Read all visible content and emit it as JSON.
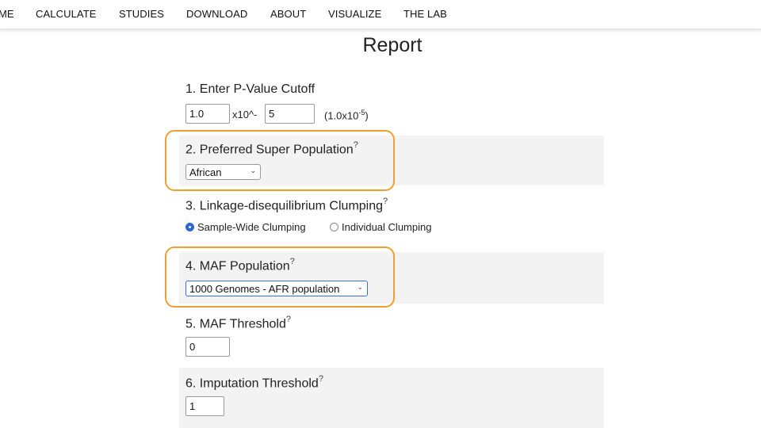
{
  "nav": {
    "items": [
      "ME",
      "CALCULATE",
      "STUDIES",
      "DOWNLOAD",
      "ABOUT",
      "VISUALIZE",
      "THE LAB"
    ]
  },
  "page": {
    "title": "Report"
  },
  "sections": {
    "pvalue": {
      "label": "1. Enter P-Value Cutoff",
      "mantissa": "1.0",
      "times_text": "x10^-",
      "exponent": "5",
      "display_base": "(1.0x10",
      "display_exp": "-5",
      "display_close": ")"
    },
    "super_population": {
      "label": "2. Preferred Super Population",
      "help": "?",
      "selected": "African"
    },
    "ld_clumping": {
      "label": "3. Linkage-disequilibrium Clumping",
      "help": "?",
      "options": [
        "Sample-Wide Clumping",
        "Individual Clumping"
      ],
      "selected_index": 0
    },
    "maf_population": {
      "label": "4. MAF Population",
      "help": "?",
      "selected": "1000 Genomes - AFR population"
    },
    "maf_threshold": {
      "label": "5. MAF Threshold",
      "help": "?",
      "value": "0"
    },
    "imputation_threshold": {
      "label": "6. Imputation Threshold",
      "help": "?",
      "value": "1"
    }
  },
  "colors": {
    "highlight": "#f0a030",
    "section_shade": "#f3f3f3",
    "radio_accent": "#2b67d6"
  }
}
